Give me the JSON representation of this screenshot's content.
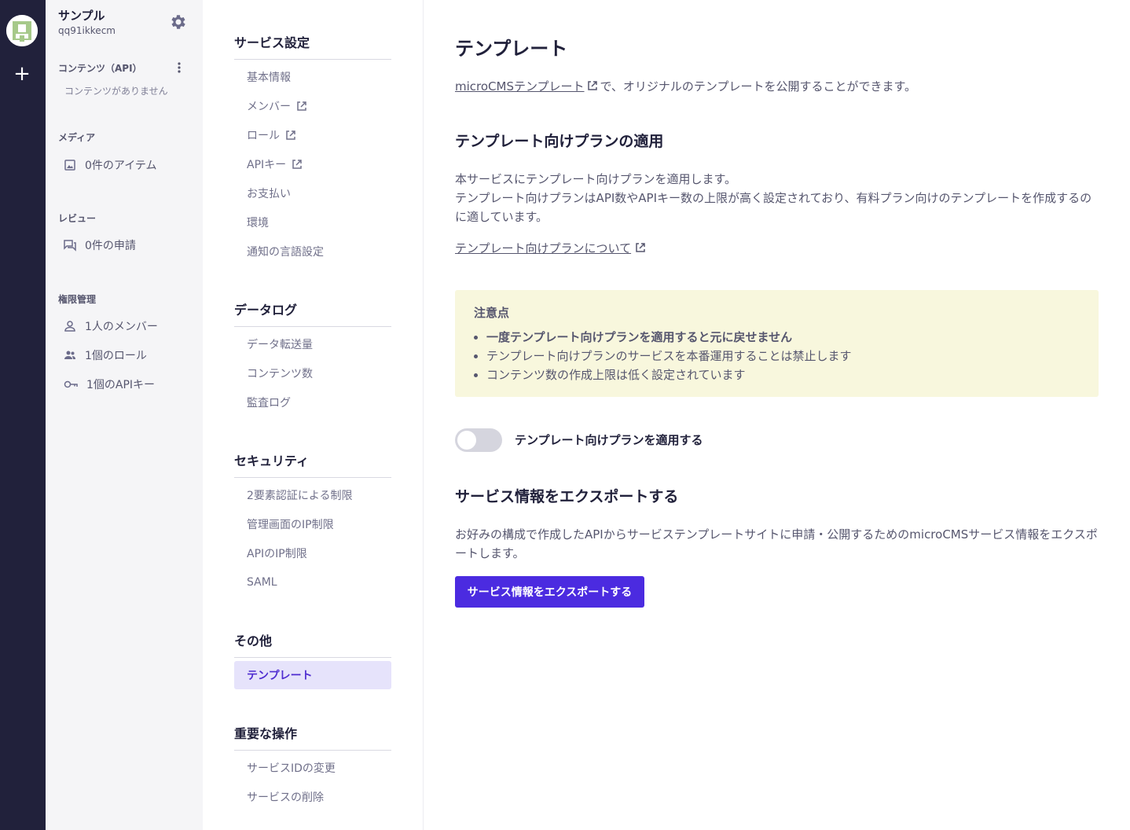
{
  "rail": {
    "add_label": "+"
  },
  "service": {
    "name": "サンプル",
    "id": "qq91ikkecm"
  },
  "sidebar": {
    "contents_heading": "コンテンツ（API）",
    "contents_empty": "コンテンツがありません",
    "media_heading": "メディア",
    "media_item": "0件のアイテム",
    "review_heading": "レビュー",
    "review_item": "0件の申請",
    "perm_heading": "権限管理",
    "perm_items": [
      "1人のメンバー",
      "1個のロール",
      "1個のAPIキー"
    ]
  },
  "menu": {
    "sections": [
      {
        "title": "サービス設定",
        "items": [
          "基本情報",
          "メンバー",
          "ロール",
          "APIキー",
          "お支払い",
          "環境",
          "通知の言語設定"
        ]
      },
      {
        "title": "データログ",
        "items": [
          "データ転送量",
          "コンテンツ数",
          "監査ログ"
        ]
      },
      {
        "title": "セキュリティ",
        "items": [
          "2要素認証による制限",
          "管理画面のIP制限",
          "APIのIP制限",
          "SAML"
        ]
      },
      {
        "title": "その他",
        "items": [
          "テンプレート"
        ]
      },
      {
        "title": "重要な操作",
        "items": [
          "サービスIDの変更",
          "サービスの削除"
        ]
      }
    ]
  },
  "main": {
    "title": "テンプレート",
    "intro_link": "microCMSテンプレート",
    "intro_text": "で、オリジナルのテンプレートを公開することができます。",
    "plan_heading": "テンプレート向けプランの適用",
    "plan_desc_1": "本サービスにテンプレート向けプランを適用します。",
    "plan_desc_2": "テンプレート向けプランはAPI数やAPIキー数の上限が高く設定されており、有料プラン向けのテンプレートを作成するのに適しています。",
    "plan_link": "テンプレート向けプランについて",
    "note_title": "注意点",
    "note_items": [
      "一度テンプレート向けプランを適用すると元に戻せません",
      "テンプレート向けプランのサービスを本番運用することは禁止します",
      "コンテンツ数の作成上限は低く設定されています"
    ],
    "toggle_label": "テンプレート向けプランを適用する",
    "toggle_on": false,
    "export_heading": "サービス情報をエクスポートする",
    "export_desc": "お好みの構成で作成したAPIからサービステンプレートサイトに申請・公開するためのmicroCMSサービス情報をエクスポートします。",
    "export_button": "サービス情報をエクスポートする"
  },
  "colors": {
    "rail": "#21213b",
    "accent": "#4b2be0",
    "note_bg": "#f8f7dd",
    "active_bg": "#e6e3fb"
  }
}
